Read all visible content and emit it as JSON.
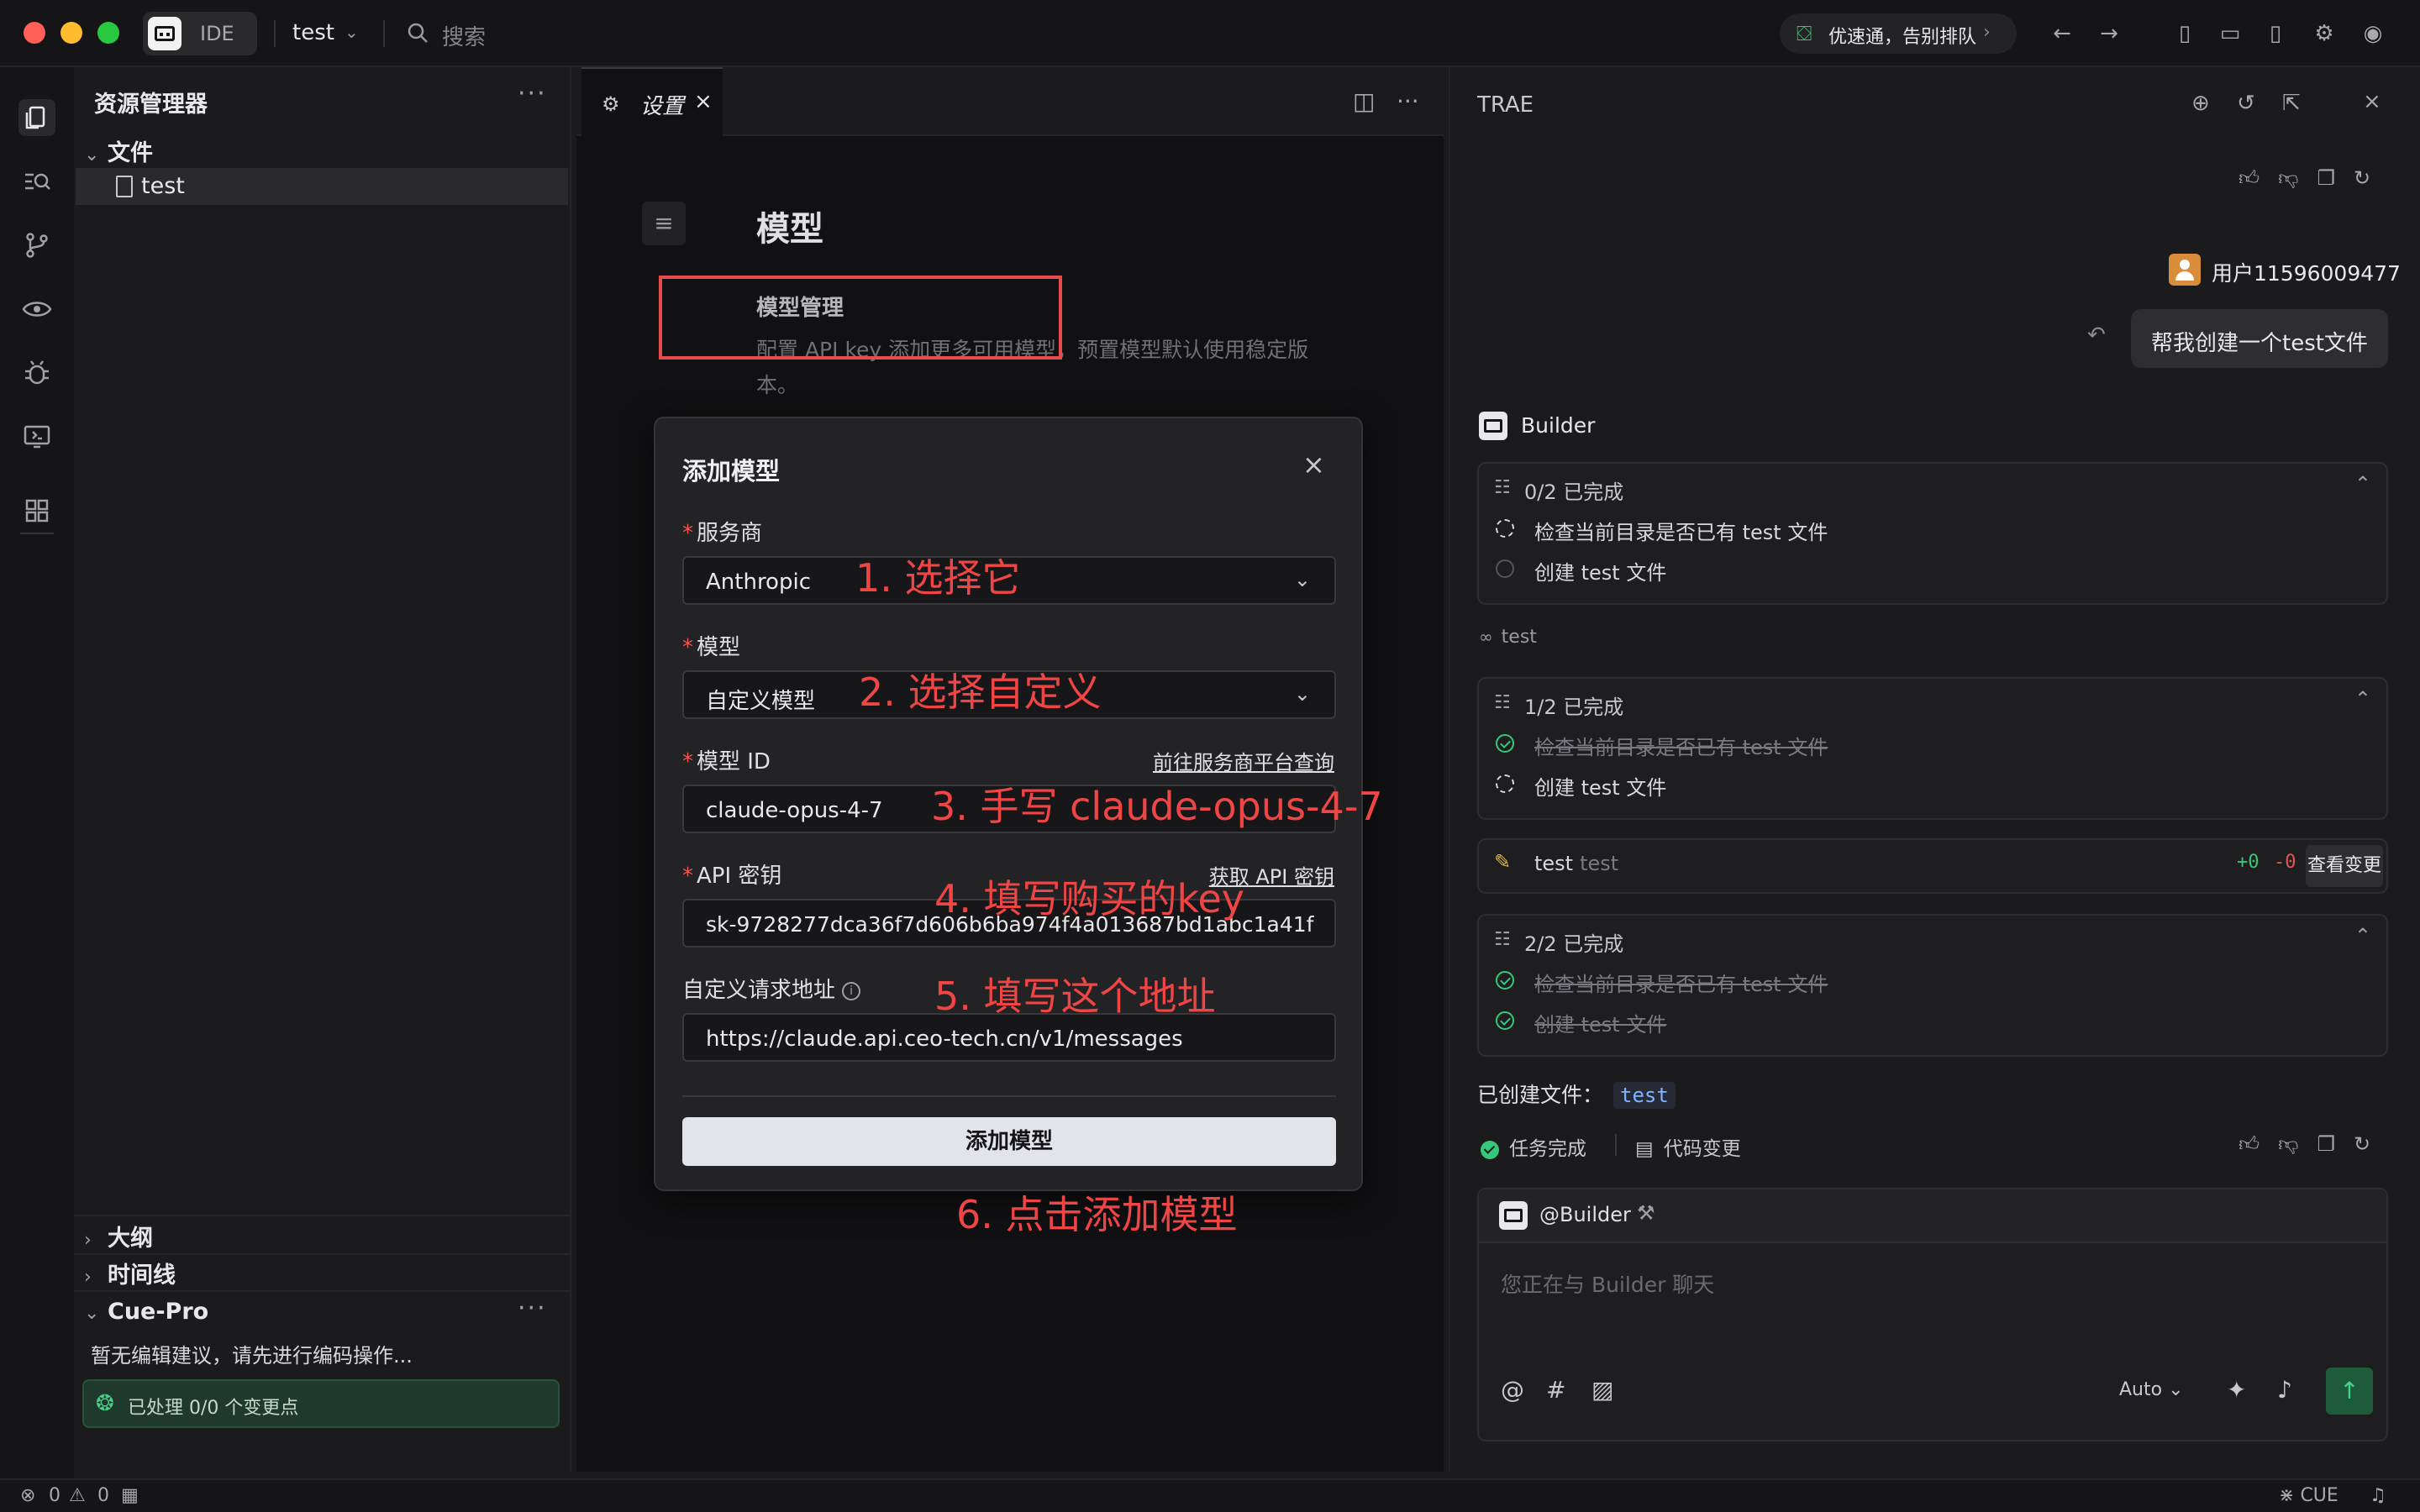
{
  "titlebar": {
    "app_name": "IDE",
    "project": "test",
    "search_placeholder": "搜索",
    "promo": "优速通，告别排队"
  },
  "explorer": {
    "title": "资源管理器",
    "files_section": "文件",
    "files": [
      "test"
    ],
    "outline": "大纲",
    "timeline": "时间线",
    "cue_title": "Cue-Pro",
    "cue_note": "暂无编辑建议，请先进行编码操作...",
    "cue_status": "已处理 0/0 个变更点"
  },
  "editor": {
    "tab_label": "设置",
    "page_title": "模型",
    "section_title": "模型管理",
    "section_desc": "配置 API key 添加更多可用模型，预置模型默认使用稳定版本。"
  },
  "modal": {
    "title": "添加模型",
    "provider_label": "服务商",
    "provider_value": "Anthropic",
    "model_label": "模型",
    "model_value": "自定义模型",
    "model_id_label": "模型 ID",
    "model_id_link": "前往服务商平台查询",
    "model_id_value": "claude-opus-4-7",
    "api_key_label": "API 密钥",
    "api_key_link": "获取 API 密钥",
    "api_key_value": "sk-9728277dca36f7d606b6ba974f4a013687bd1abc1a41f",
    "url_label": "自定义请求地址",
    "url_value": "https://claude.api.ceo-tech.cn/v1/messages",
    "submit": "添加模型"
  },
  "annotations": {
    "a1": "1. 选择它",
    "a2": "2. 选择自定义",
    "a3": "3. 手写 claude-opus-4-7",
    "a4": "4. 填写购买的key",
    "a5": "5. 填写这个地址",
    "a6": "6. 点击添加模型"
  },
  "chat": {
    "title": "TRAE",
    "user_name": "用户11596009477",
    "user_message": "帮我创建一个test文件",
    "agent_name": "Builder",
    "card1_head": "0/2 已完成",
    "card2_head": "1/2 已完成",
    "card3_head": "2/2 已完成",
    "step1": "检查当前目录是否已有 test 文件",
    "step2": "创建 test 文件",
    "thinking": "test",
    "diff_file": "test",
    "diff_path": "test",
    "diff_add": "+0",
    "diff_del": "-0",
    "diff_button": "查看变更",
    "created_label": "已创建文件：",
    "created_file": "test",
    "task_done": "任务完成",
    "code_changes": "代码变更",
    "mention": "@Builder",
    "input_placeholder": "您正在与 Builder 聊天",
    "mode": "Auto"
  },
  "statusbar": {
    "errors": "0",
    "warnings": "0",
    "cue": "CUE"
  }
}
